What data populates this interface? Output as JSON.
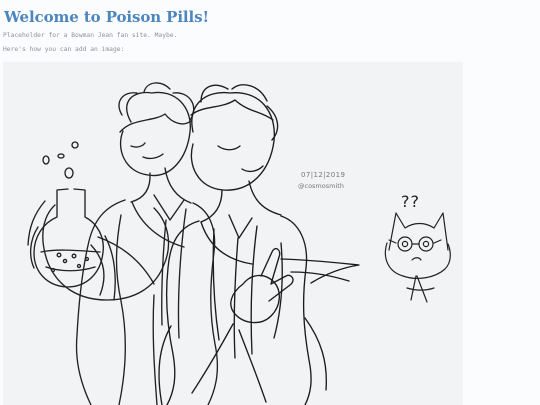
{
  "page": {
    "title": "Welcome to Poison Pills!",
    "intro": "Placeholder for a Bowman Jean fan site. Maybe.",
    "howto": "Here's how you can add an image:"
  },
  "image": {
    "date_caption": "07|12|2019",
    "artist_handle": "@cosmosmith",
    "question_marks": "??"
  },
  "colors": {
    "title": "#4d86bf",
    "body_text": "#8d9299",
    "image_background": "#f2f3f4",
    "ink": "#222222"
  },
  "icons": {
    "artwork": "line-art-illustration"
  }
}
